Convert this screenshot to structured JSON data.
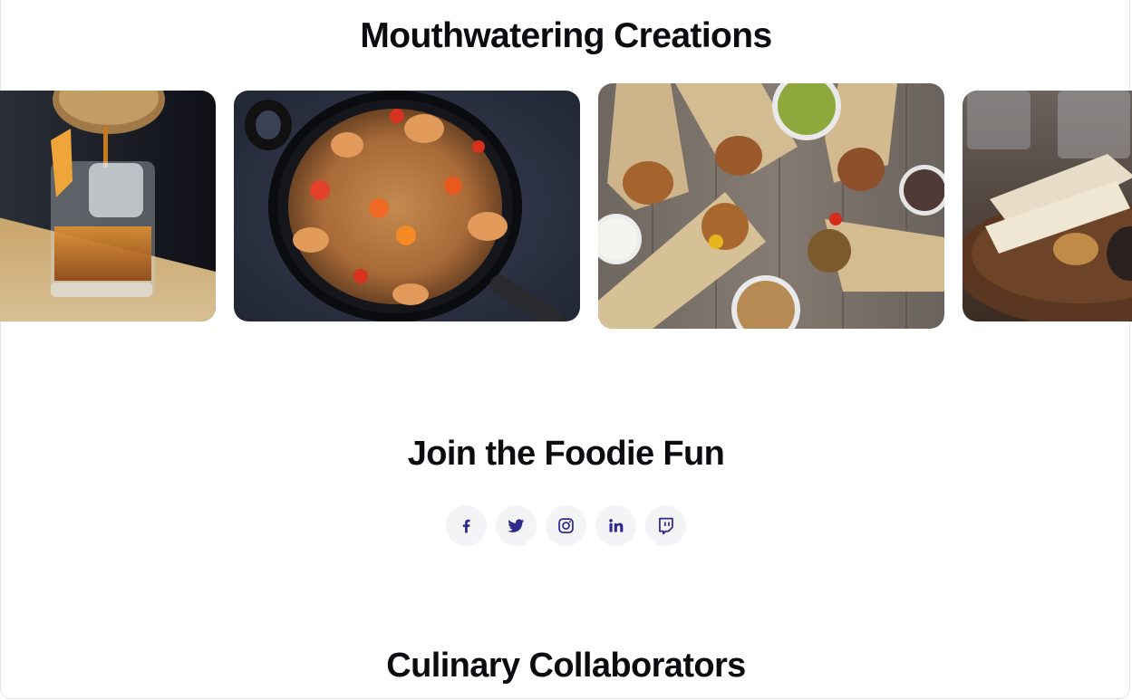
{
  "sections": {
    "gallery": {
      "title": "Mouthwatering Creations",
      "images": [
        {
          "alt": "Old fashioned cocktail being strained over ice"
        },
        {
          "alt": "Shrimp spaghetti with cherry tomatoes in a black pan"
        },
        {
          "alt": "Assorted burrito wraps with dipping sauces"
        },
        {
          "alt": "Grilled fish fillets on a plate"
        }
      ]
    },
    "social": {
      "title": "Join the Foodie Fun",
      "icon_color": "#2e2a8c",
      "links": [
        {
          "name": "facebook",
          "icon": "facebook-icon"
        },
        {
          "name": "twitter",
          "icon": "twitter-icon"
        },
        {
          "name": "instagram",
          "icon": "instagram-icon"
        },
        {
          "name": "linkedin",
          "icon": "linkedin-icon"
        },
        {
          "name": "twitch",
          "icon": "twitch-icon"
        }
      ]
    },
    "collaborators": {
      "title": "Culinary Collaborators"
    }
  }
}
